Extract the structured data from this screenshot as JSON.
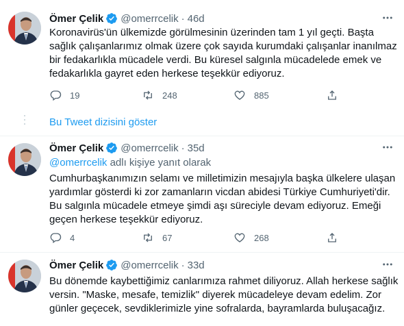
{
  "colors": {
    "accent": "#1d9bf0",
    "verified": "#1d9bf0",
    "secondary_text": "#536471"
  },
  "show_thread_label": "Bu Tweet dizisini göster",
  "tweets": [
    {
      "name": "Ömer Çelik",
      "handle": "@omerrcelik",
      "dot": "·",
      "time": "46d",
      "lines": [
        "Koronavirüs'ün ülkemizde görülmesinin üzerinden tam 1 yıl geçti. Başta",
        "sağlık çalışanlarımız olmak üzere çok sayıda kurumdaki çalışanlar inanılmaz",
        "bir fedakarlıkla mücadele verdi. Bu küresel salgınla mücadelede emek ve",
        "fedakarlıkla gayret eden herkese teşekkür ediyoruz."
      ],
      "replies": "19",
      "retweets": "248",
      "likes": "885"
    },
    {
      "name": "Ömer Çelik",
      "handle": "@omerrcelik",
      "dot": "·",
      "time": "35d",
      "reply_to_handle": "@omerrcelik",
      "reply_to_suffix": " adlı kişiye yanıt olarak",
      "lines": [
        "Cumhurbaşkanımızın selamı ve milletimizin mesajıyla başka ülkelere ulaşan",
        "yardımlar gösterdi ki zor zamanların vicdan abidesi Türkiye Cumhuriyeti'dir.",
        "Bu salgınla mücadele etmeye şimdi aşı süreciyle devam ediyoruz. Emeği",
        "geçen herkese teşekkür ediyoruz."
      ],
      "replies": "4",
      "retweets": "67",
      "likes": "268"
    },
    {
      "name": "Ömer Çelik",
      "handle": "@omerrcelik",
      "dot": "·",
      "time": "33d",
      "lines": [
        "Bu dönemde kaybettiğimiz canlarımıza rahmet diliyoruz. Allah herkese sağlık",
        "versin. \"Maske, mesafe, temizlik\" diyerek mücadeleye devam edelim. Zor",
        "günler geçecek, sevdiklerimizle yine sofralarda, bayramlarda buluşacağız."
      ]
    }
  ]
}
